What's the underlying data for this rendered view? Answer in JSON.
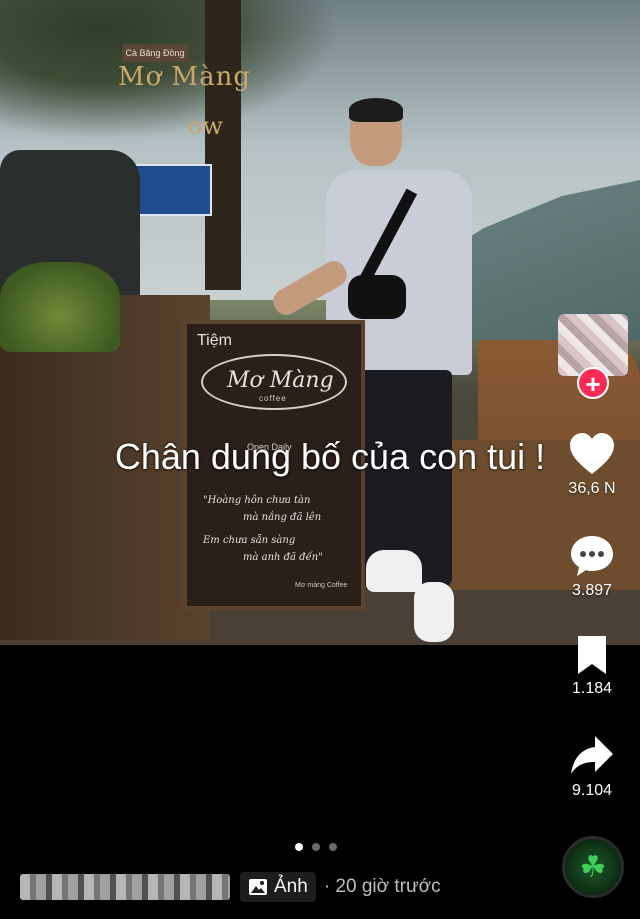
{
  "caption": "Chân dung bố của con tui !",
  "photo": {
    "sign_tiem": "Tiệm",
    "sign_logo": "Mơ Màng",
    "sign_coffee": "coffee",
    "sign_open": "Open Daily",
    "sign_poem_1": "\"Hoàng hôn chưa tàn",
    "sign_poem_2": "mà nắng đã lên",
    "sign_poem_3": "Em chưa sẵn sàng",
    "sign_poem_4": "mà anh đã đến\"",
    "sign_footer": "Mơ màng Coffee",
    "top_sign_1": "Mơ Màng",
    "top_sign_2": "ow",
    "wood_label": "Cà Băng Đồng"
  },
  "actions": {
    "likes": "36,6 N",
    "comments": "3.897",
    "saves": "1.184",
    "shares": "9.104"
  },
  "follow_symbol": "+",
  "pagination": {
    "total": 3,
    "active": 0
  },
  "bottom": {
    "type_label": "Ảnh",
    "time": "· 20 giờ trước"
  },
  "colors": {
    "follow": "#fe2c55",
    "background": "#000000"
  },
  "icons": [
    "heart-icon",
    "comment-icon",
    "bookmark-icon",
    "share-icon",
    "photo-icon",
    "music-disc-icon"
  ]
}
